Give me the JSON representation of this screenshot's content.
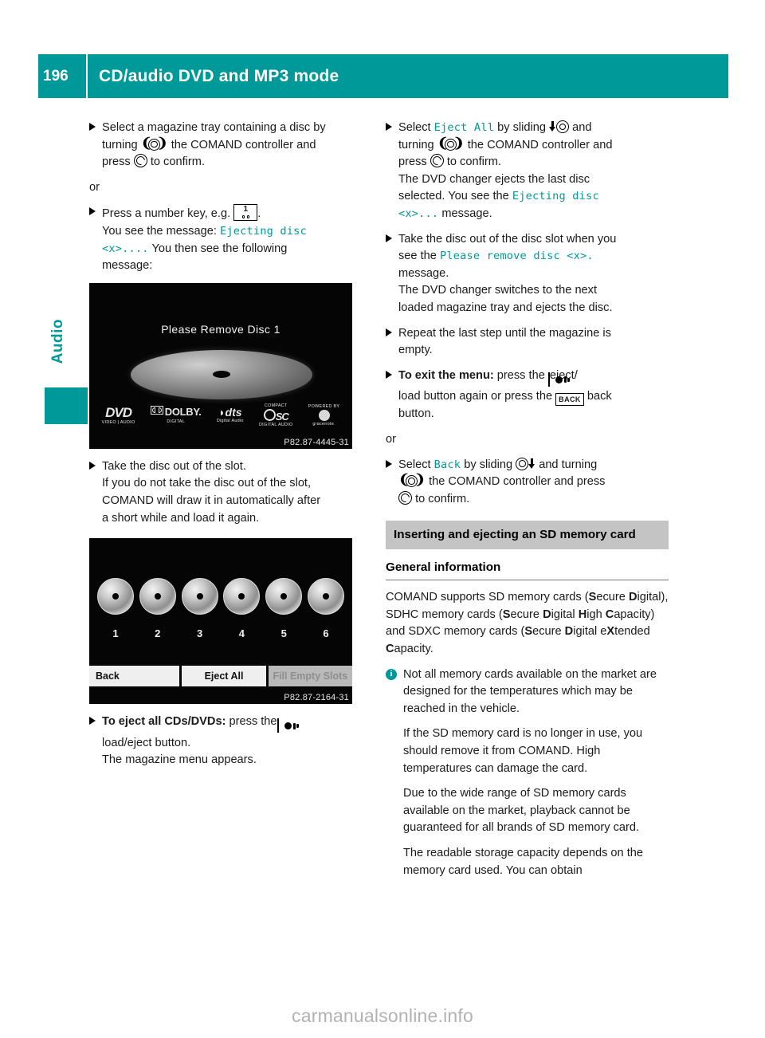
{
  "header": {
    "page_number": "196",
    "title": "CD/audio DVD and MP3 mode",
    "accent_color": "#009999"
  },
  "sidebar": {
    "tab_label": "Audio"
  },
  "left_column": {
    "step1": {
      "line1": "Select a magazine tray containing a disc by",
      "line2_a": "turning",
      "line2_b": "the COMAND controller and",
      "line3_a": "press",
      "line3_b": "to confirm."
    },
    "or_label": "or",
    "step2": {
      "line1_a": "Press a number key, e.g.",
      "line1_b": ".",
      "numkey_digit": "1",
      "line2_a": "You see the message:",
      "line2_mono": "Ejecting disc",
      "line3_mono": "<x>....",
      "line3_b": "You then see the following",
      "line4": "message:"
    },
    "figure1": {
      "screen_title": "Please Remove Disc 1",
      "caption": "P82.87-4445-31",
      "logos": [
        {
          "name": "DVD",
          "sub": "VIDEO | AUDIO"
        },
        {
          "name": "DOLBY",
          "sub": "DIGITAL"
        },
        {
          "name": "dts",
          "sub": "Digital Audio"
        },
        {
          "name": "COMPACT disc",
          "sub": "DIGITAL AUDIO"
        },
        {
          "name": "gracenote.",
          "sub": "POWERED BY"
        }
      ]
    },
    "step3": {
      "line1": "Take the disc out of the slot.",
      "line2": "If you do not take the disc out of the slot,",
      "line3": "COMAND will draw it in automatically after",
      "line4": "a short while and load it again."
    },
    "figure2": {
      "disc_numbers": [
        "1",
        "2",
        "3",
        "4",
        "5",
        "6"
      ],
      "buttons": [
        "Back",
        "Eject All",
        "Fill Empty Slots"
      ],
      "caption": "P82.87-2164-31"
    },
    "step4": {
      "line1_bold": "To eject all CDs/DVDs:",
      "line1_a": "press the",
      "line2": "load/eject button.",
      "line3": "The magazine menu appears."
    }
  },
  "right_column": {
    "step1": {
      "line1_a": "Select",
      "line1_mono": "Eject All",
      "line1_b": "by sliding",
      "line1_c": "and",
      "line2_a": "turning",
      "line2_b": "the COMAND controller and",
      "line3_a": "press",
      "line3_b": "to confirm.",
      "line4": "The DVD changer ejects the last disc",
      "line5_a": "selected. You see the",
      "line5_mono": "Ejecting disc",
      "line6_mono": "<x>...",
      "line6_b": "message."
    },
    "step2": {
      "line1": "Take the disc out of the disc slot when you",
      "line2_a": "see the",
      "line2_mono": "Please remove disc <x>.",
      "line3": "message.",
      "line4": "The DVD changer switches to the next",
      "line5": "loaded magazine tray and ejects the disc."
    },
    "step3": {
      "line1": "Repeat the last step until the magazine is",
      "line2": "empty."
    },
    "step4": {
      "line1_bold": "To exit the menu:",
      "line1_a": "press the",
      "line1_b": "eject/",
      "line2_a": "load button again or press the",
      "line2_back": "BACK",
      "line2_b": "back",
      "line3": "button."
    },
    "or_label": "or",
    "step5": {
      "line1_a": "Select",
      "line1_mono": "Back",
      "line1_b": "by sliding",
      "line1_c": "and turning",
      "line2_a": "the COMAND controller and press",
      "line3_a": "to confirm."
    },
    "section": {
      "heading": "Inserting and ejecting an SD memory card",
      "subheading": "General information",
      "body": {
        "p1_seg": [
          "COMAND supports SD memory cards",
          "(",
          "S",
          "ecure ",
          "D",
          "igital), SDHC memory cards",
          "(",
          "S",
          "ecure ",
          "D",
          "igital ",
          "H",
          "igh ",
          "C",
          "apacity) and SDXC",
          "memory cards (",
          "S",
          "ecure ",
          "D",
          "igital e",
          "X",
          "tended",
          "C",
          "apacity."
        ],
        "note1": "Not all memory cards available on the market are designed for the temperatures which may be reached in the vehicle.",
        "note2": "If the SD memory card is no longer in use, you should remove it from COMAND. High temperatures can damage the card.",
        "note3": "Due to the wide range of SD memory cards available on the market, playback cannot be guaranteed for all brands of SD memory card.",
        "note4": "The readable storage capacity depends on the memory card used. You can obtain"
      }
    }
  },
  "watermark": "carmanualsonline.info"
}
